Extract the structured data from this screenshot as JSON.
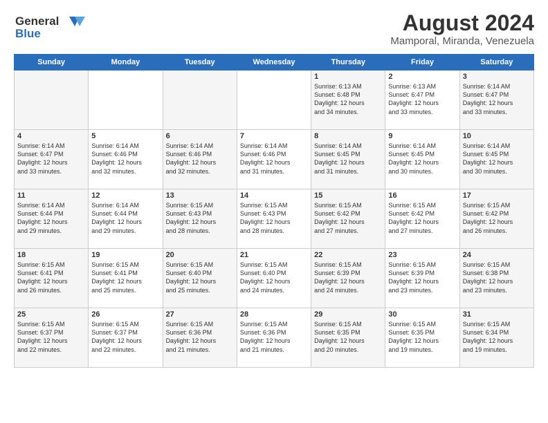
{
  "header": {
    "logo_general": "General",
    "logo_blue": "Blue",
    "title": "August 2024",
    "subtitle": "Mamporal, Miranda, Venezuela"
  },
  "calendar": {
    "weekdays": [
      "Sunday",
      "Monday",
      "Tuesday",
      "Wednesday",
      "Thursday",
      "Friday",
      "Saturday"
    ],
    "weeks": [
      [
        {
          "day": "",
          "info": ""
        },
        {
          "day": "",
          "info": ""
        },
        {
          "day": "",
          "info": ""
        },
        {
          "day": "",
          "info": ""
        },
        {
          "day": "1",
          "info": "Sunrise: 6:13 AM\nSunset: 6:48 PM\nDaylight: 12 hours\nand 34 minutes."
        },
        {
          "day": "2",
          "info": "Sunrise: 6:13 AM\nSunset: 6:47 PM\nDaylight: 12 hours\nand 33 minutes."
        },
        {
          "day": "3",
          "info": "Sunrise: 6:14 AM\nSunset: 6:47 PM\nDaylight: 12 hours\nand 33 minutes."
        }
      ],
      [
        {
          "day": "4",
          "info": "Sunrise: 6:14 AM\nSunset: 6:47 PM\nDaylight: 12 hours\nand 33 minutes."
        },
        {
          "day": "5",
          "info": "Sunrise: 6:14 AM\nSunset: 6:46 PM\nDaylight: 12 hours\nand 32 minutes."
        },
        {
          "day": "6",
          "info": "Sunrise: 6:14 AM\nSunset: 6:46 PM\nDaylight: 12 hours\nand 32 minutes."
        },
        {
          "day": "7",
          "info": "Sunrise: 6:14 AM\nSunset: 6:46 PM\nDaylight: 12 hours\nand 31 minutes."
        },
        {
          "day": "8",
          "info": "Sunrise: 6:14 AM\nSunset: 6:45 PM\nDaylight: 12 hours\nand 31 minutes."
        },
        {
          "day": "9",
          "info": "Sunrise: 6:14 AM\nSunset: 6:45 PM\nDaylight: 12 hours\nand 30 minutes."
        },
        {
          "day": "10",
          "info": "Sunrise: 6:14 AM\nSunset: 6:45 PM\nDaylight: 12 hours\nand 30 minutes."
        }
      ],
      [
        {
          "day": "11",
          "info": "Sunrise: 6:14 AM\nSunset: 6:44 PM\nDaylight: 12 hours\nand 29 minutes."
        },
        {
          "day": "12",
          "info": "Sunrise: 6:14 AM\nSunset: 6:44 PM\nDaylight: 12 hours\nand 29 minutes."
        },
        {
          "day": "13",
          "info": "Sunrise: 6:15 AM\nSunset: 6:43 PM\nDaylight: 12 hours\nand 28 minutes."
        },
        {
          "day": "14",
          "info": "Sunrise: 6:15 AM\nSunset: 6:43 PM\nDaylight: 12 hours\nand 28 minutes."
        },
        {
          "day": "15",
          "info": "Sunrise: 6:15 AM\nSunset: 6:42 PM\nDaylight: 12 hours\nand 27 minutes."
        },
        {
          "day": "16",
          "info": "Sunrise: 6:15 AM\nSunset: 6:42 PM\nDaylight: 12 hours\nand 27 minutes."
        },
        {
          "day": "17",
          "info": "Sunrise: 6:15 AM\nSunset: 6:42 PM\nDaylight: 12 hours\nand 26 minutes."
        }
      ],
      [
        {
          "day": "18",
          "info": "Sunrise: 6:15 AM\nSunset: 6:41 PM\nDaylight: 12 hours\nand 26 minutes."
        },
        {
          "day": "19",
          "info": "Sunrise: 6:15 AM\nSunset: 6:41 PM\nDaylight: 12 hours\nand 25 minutes."
        },
        {
          "day": "20",
          "info": "Sunrise: 6:15 AM\nSunset: 6:40 PM\nDaylight: 12 hours\nand 25 minutes."
        },
        {
          "day": "21",
          "info": "Sunrise: 6:15 AM\nSunset: 6:40 PM\nDaylight: 12 hours\nand 24 minutes."
        },
        {
          "day": "22",
          "info": "Sunrise: 6:15 AM\nSunset: 6:39 PM\nDaylight: 12 hours\nand 24 minutes."
        },
        {
          "day": "23",
          "info": "Sunrise: 6:15 AM\nSunset: 6:39 PM\nDaylight: 12 hours\nand 23 minutes."
        },
        {
          "day": "24",
          "info": "Sunrise: 6:15 AM\nSunset: 6:38 PM\nDaylight: 12 hours\nand 23 minutes."
        }
      ],
      [
        {
          "day": "25",
          "info": "Sunrise: 6:15 AM\nSunset: 6:37 PM\nDaylight: 12 hours\nand 22 minutes."
        },
        {
          "day": "26",
          "info": "Sunrise: 6:15 AM\nSunset: 6:37 PM\nDaylight: 12 hours\nand 22 minutes."
        },
        {
          "day": "27",
          "info": "Sunrise: 6:15 AM\nSunset: 6:36 PM\nDaylight: 12 hours\nand 21 minutes."
        },
        {
          "day": "28",
          "info": "Sunrise: 6:15 AM\nSunset: 6:36 PM\nDaylight: 12 hours\nand 21 minutes."
        },
        {
          "day": "29",
          "info": "Sunrise: 6:15 AM\nSunset: 6:35 PM\nDaylight: 12 hours\nand 20 minutes."
        },
        {
          "day": "30",
          "info": "Sunrise: 6:15 AM\nSunset: 6:35 PM\nDaylight: 12 hours\nand 19 minutes."
        },
        {
          "day": "31",
          "info": "Sunrise: 6:15 AM\nSunset: 6:34 PM\nDaylight: 12 hours\nand 19 minutes."
        }
      ]
    ]
  }
}
